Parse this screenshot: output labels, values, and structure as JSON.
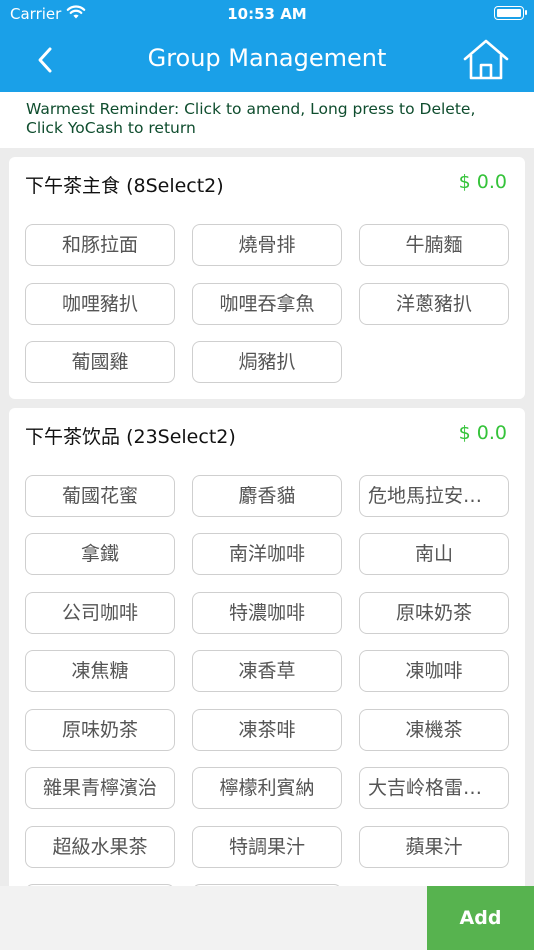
{
  "status": {
    "carrier": "Carrier",
    "time": "10:53 AM"
  },
  "nav": {
    "title": "Group Management",
    "back_icon": "chevron-left-icon",
    "home_icon": "home-icon"
  },
  "reminder": {
    "line1": "Warmest Reminder: Click to amend, Long press to Delete,",
    "line2": "Click YoCash to return"
  },
  "groups": [
    {
      "name": "下午茶主食",
      "rule": "(8Select2)",
      "price": "$ 0.0",
      "items": [
        "和豚拉面",
        "燒骨排",
        "牛腩麵",
        "咖哩豬扒",
        "咖哩吞拿魚",
        "洋蔥豬扒",
        "葡國雞",
        "焗豬扒"
      ]
    },
    {
      "name": "下午茶饮品",
      "rule": "(23Select2)",
      "price": "$ 0.0",
      "items": [
        "葡國花蜜",
        "麝香貓",
        "危地馬拉安提瓜",
        "拿鐵",
        "南洋咖啡",
        "南山",
        "公司咖啡",
        "特濃咖啡",
        "原味奶茶",
        "凍焦糖",
        "凍香草",
        "凍咖啡",
        "原味奶茶",
        "凍茶啡",
        "凍機茶",
        "雜果青檸濱治",
        "檸檬利賓納",
        "大吉岭格雷伯爵",
        "超級水果茶",
        "特調果汁",
        "蘋果汁"
      ]
    }
  ],
  "actions": {
    "add_label": "Add"
  },
  "colors": {
    "header_bg": "#1aa0e8",
    "price": "#35c33a",
    "add_button": "#57b34f",
    "reminder_text": "#0f4d2e"
  }
}
